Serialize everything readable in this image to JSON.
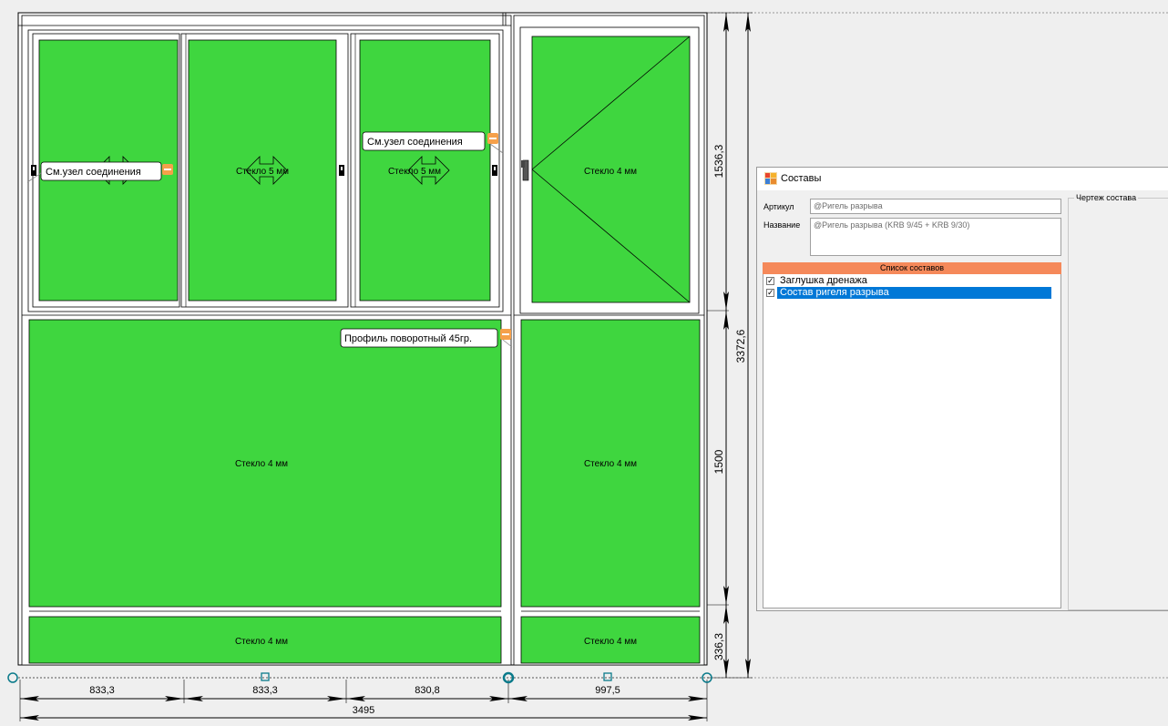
{
  "drawing": {
    "glass_labels": {
      "top_left": "",
      "top_mid": "Стекло 5 мм",
      "top_right": "Стекло 5 мм",
      "right_top": "Стекло 4 мм",
      "middle_left": "Стекло 4 мм",
      "middle_right": "Стекло 4 мм",
      "bottom_left": "Стекло 4 мм",
      "bottom_right": "Стекло 4 мм"
    },
    "callouts": {
      "left_connection": "См.узел соединения",
      "right_connection": "См.узел соединения",
      "rotary_profile": "Профиль поворотный 45гр."
    },
    "dimensions": {
      "h_833a": "833,3",
      "h_833b": "833,3",
      "h_830": "830,8",
      "h_997": "997,5",
      "h_total": "3495",
      "v_1536": "1536,3",
      "v_1500": "1500",
      "v_336": "336,3",
      "v_total": "3372,6"
    },
    "colors": {
      "glass": "#3fd63f",
      "frame": "#ffffff",
      "line": "#000000"
    }
  },
  "dialog": {
    "title": "Составы",
    "icon": "palette-icon",
    "article_label": "Артикул",
    "article_value": "@Ригель разрыва",
    "name_label": "Название",
    "name_value": "@Ригель разрыва (KRB 9/45 + KRB 9/30)",
    "list_header": "Список составов",
    "items": [
      {
        "label": "Заглушка дренажа",
        "checked": true,
        "selected": false
      },
      {
        "label": "Состав ригеля разрыва",
        "checked": true,
        "selected": true
      }
    ],
    "drawing_group_label": "Чертеж состава",
    "colors": {
      "list_header": "#f5895a",
      "selection": "#0078d7"
    }
  }
}
